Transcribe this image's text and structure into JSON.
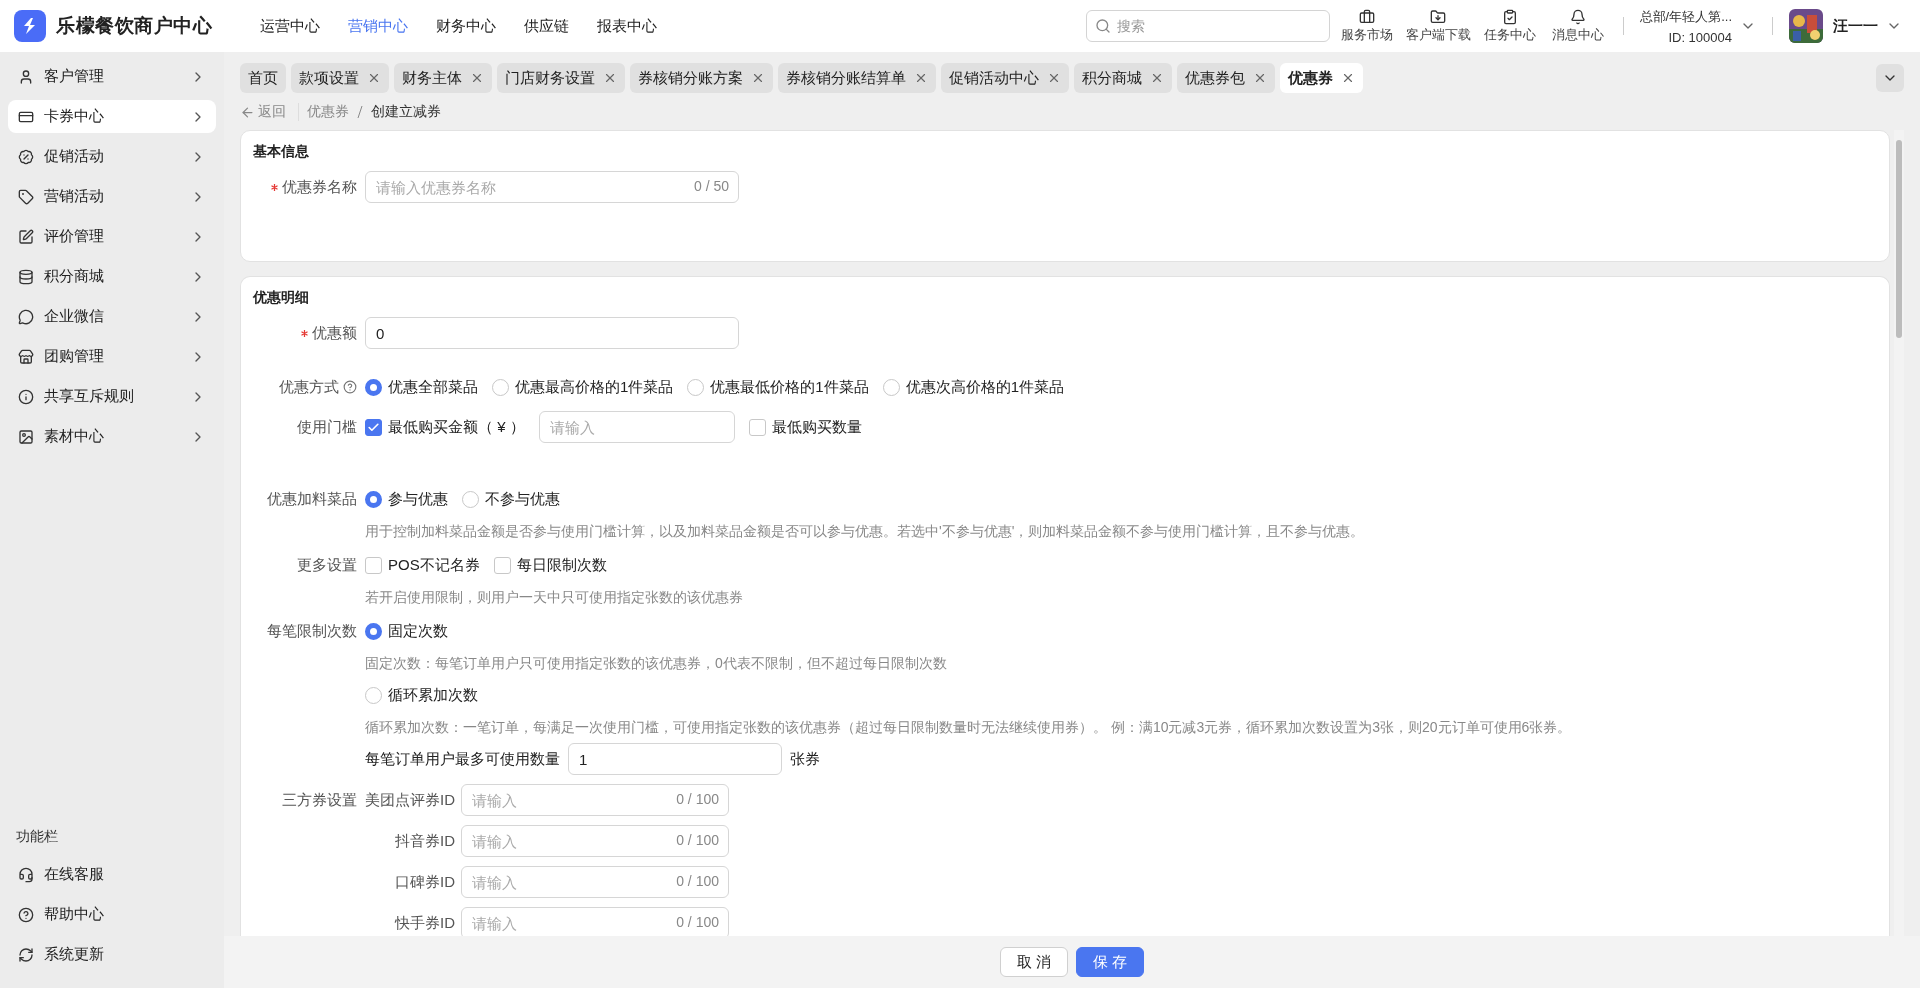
{
  "app": {
    "logo_text": "乐檬餐饮商户中心",
    "nav": [
      {
        "label": "运营中心",
        "selected": false
      },
      {
        "label": "营销中心",
        "selected": true
      },
      {
        "label": "财务中心",
        "selected": false
      },
      {
        "label": "供应链",
        "selected": false
      },
      {
        "label": "报表中心",
        "selected": false
      }
    ]
  },
  "search": {
    "placeholder": "搜索"
  },
  "tools": [
    {
      "label": "服务市场"
    },
    {
      "label": "客户端下载"
    },
    {
      "label": "任务中心"
    },
    {
      "label": "消息中心"
    }
  ],
  "org": {
    "name": "总部/年轻人第...",
    "id": "ID: 100004"
  },
  "user": {
    "name": "汪一一"
  },
  "sidebar": {
    "items": [
      {
        "label": "客户管理",
        "selected": false
      },
      {
        "label": "卡券中心",
        "selected": true
      },
      {
        "label": "促销活动",
        "selected": false
      },
      {
        "label": "营销活动",
        "selected": false
      },
      {
        "label": "评价管理",
        "selected": false
      },
      {
        "label": "积分商城",
        "selected": false
      },
      {
        "label": "企业微信",
        "selected": false
      },
      {
        "label": "团购管理",
        "selected": false
      },
      {
        "label": "共享互斥规则",
        "selected": false
      },
      {
        "label": "素材中心",
        "selected": false
      }
    ],
    "footer_title": "功能栏",
    "footer_items": [
      {
        "label": "在线客服"
      },
      {
        "label": "帮助中心"
      },
      {
        "label": "系统更新"
      }
    ]
  },
  "tabs": [
    {
      "label": "首页",
      "closable": false,
      "selected": false
    },
    {
      "label": "款项设置",
      "closable": true,
      "selected": false
    },
    {
      "label": "财务主体",
      "closable": true,
      "selected": false
    },
    {
      "label": "门店财务设置",
      "closable": true,
      "selected": false
    },
    {
      "label": "券核销分账方案",
      "closable": true,
      "selected": false
    },
    {
      "label": "券核销分账结算单",
      "closable": true,
      "selected": false
    },
    {
      "label": "促销活动中心",
      "closable": true,
      "selected": false
    },
    {
      "label": "积分商城",
      "closable": true,
      "selected": false
    },
    {
      "label": "优惠券包",
      "closable": true,
      "selected": false
    },
    {
      "label": "优惠券",
      "closable": true,
      "selected": true
    }
  ],
  "breadcrumb": {
    "back": "返回",
    "items": [
      "优惠券",
      "创建立减券"
    ]
  },
  "sections": [
    {
      "title": "基本信息",
      "rows": [
        {
          "kind": "text_input",
          "label": "优惠券名称",
          "required": true,
          "placeholder": "请输入优惠券名称",
          "counter": "0 / 50"
        }
      ]
    },
    {
      "title": "优惠明细",
      "rows": [
        {
          "kind": "text_input",
          "label": "优惠额",
          "required": true,
          "value": "0"
        },
        {
          "kind": "radio_group",
          "label": "优惠方式",
          "help": true,
          "options": [
            {
              "label": "优惠全部菜品",
              "selected": true
            },
            {
              "label": "优惠最高价格的1件菜品",
              "selected": false
            },
            {
              "label": "优惠最低价格的1件菜品",
              "selected": false
            },
            {
              "label": "优惠次高价格的1件菜品",
              "selected": false
            }
          ]
        },
        {
          "kind": "threshold",
          "label": "使用门槛",
          "options": [
            {
              "kind": "checkbox_input",
              "label": "最低购买金额（ ¥ ）",
              "checked": true,
              "placeholder": "请输入"
            },
            {
              "kind": "checkbox",
              "label": "最低购买数量",
              "checked": false
            }
          ]
        },
        {
          "kind": "radio_group",
          "label": "优惠加料菜品",
          "options": [
            {
              "label": "参与优惠",
              "selected": true
            },
            {
              "label": "不参与优惠",
              "selected": false
            }
          ],
          "hint": "用于控制加料菜品金额是否参与使用门槛计算，以及加料菜品金额是否可以参与优惠。若选中'不参与优惠'，则加料菜品金额不参与使用门槛计算，且不参与优惠。"
        },
        {
          "kind": "checkbox_group",
          "label": "更多设置",
          "options": [
            {
              "label": "POS不记名券",
              "checked": false
            },
            {
              "label": "每日限制次数",
              "checked": false
            }
          ],
          "hint": "若开启使用限制，则用户一天中只可使用指定张数的该优惠券"
        },
        {
          "kind": "radio_stack",
          "label": "每笔限制次数",
          "options": [
            {
              "label": "固定次数",
              "selected": true,
              "hint": "固定次数：每笔订单用户只可使用指定张数的该优惠券，0代表不限制，但不超过每日限制次数"
            },
            {
              "label": "循环累加次数",
              "selected": false,
              "hint": "循环累加次数：一笔订单，每满足一次使用门槛，可使用指定张数的该优惠券（超过每日限制数量时无法继续使用券）。 例：满10元减3元券，循环累加次数设置为3张，则20元订单可使用6张券。"
            }
          ],
          "extra": {
            "label": "每笔订单用户最多可使用数量",
            "value": "1",
            "unit": "张券"
          }
        },
        {
          "kind": "id_inputs",
          "label": "三方券设置",
          "fields": [
            {
              "label": "美团点评券ID",
              "placeholder": "请输入",
              "counter": "0 / 100"
            },
            {
              "label": "抖音券ID",
              "placeholder": "请输入",
              "counter": "0 / 100"
            },
            {
              "label": "口碑券ID",
              "placeholder": "请输入",
              "counter": "0 / 100"
            },
            {
              "label": "快手券ID",
              "placeholder": "请输入",
              "counter": "0 / 100"
            }
          ]
        }
      ]
    }
  ],
  "footer_buttons": [
    {
      "label": "取 消",
      "kind": "default"
    },
    {
      "label": "保 存",
      "kind": "primary"
    }
  ]
}
